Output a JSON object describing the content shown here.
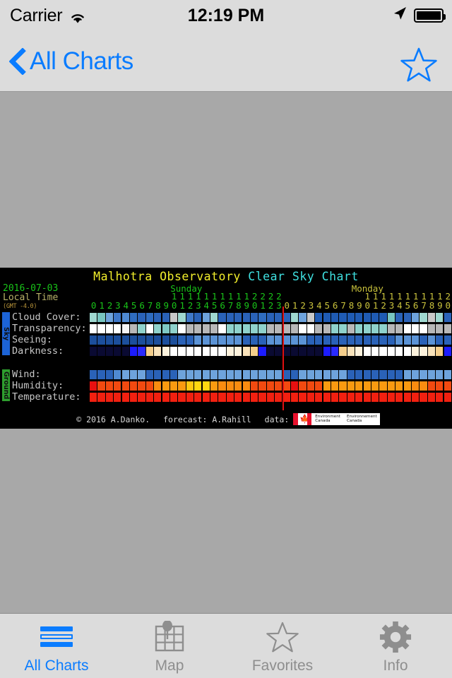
{
  "statusbar": {
    "carrier": "Carrier",
    "time": "12:19 PM",
    "wifi_icon": "wifi-icon",
    "location_icon": "location-arrow-icon",
    "battery_icon": "battery-full-icon"
  },
  "navbar": {
    "back_label": "All Charts",
    "back_icon": "chevron-left-icon",
    "favorite_icon": "star-outline-icon"
  },
  "chart": {
    "title_observatory": "Malhotra Observatory",
    "title_suffix": "Clear Sky Chart",
    "date": "2016-07-03",
    "timebase": "Local Time",
    "gmt_offset": "(GMT -4.0)",
    "colors": {
      "title_observatory": "#f2ef2c",
      "title_suffix": "#3fe0e0",
      "sunday": "#19c419",
      "monday": "#c9c23c",
      "sky_tab_bg": "#1c63d6",
      "ground_tab_bg": "#2e9e2e",
      "now_line": "#e01010",
      "background": "#000000"
    },
    "footer": {
      "copyright": "© 2016 A.Danko.",
      "forecast": "forecast: A.Rahill",
      "data_label": "data:",
      "agency_en": "Environment\nCanada",
      "agency_fr": "Environnement\nCanada",
      "flag_icon": "canada-flag-icon"
    },
    "now_line_column": 24,
    "groups": [
      {
        "tab": "Sky",
        "rows": [
          "Cloud Cover:",
          "Transparency:",
          "Seeing:",
          "Darkness:"
        ]
      },
      {
        "tab": "Ground",
        "rows": [
          "Wind:",
          "Humidity:",
          "Temperature:"
        ]
      }
    ]
  },
  "chart_data": {
    "type": "heatmap",
    "title": "Malhotra Observatory Clear Sky Chart",
    "xlabel": "Local Time (GMT -4.0)",
    "ylabel": "",
    "grid": false,
    "legend_position": "none",
    "days": [
      {
        "name": "Sunday",
        "hours": [
          0,
          1,
          2,
          3,
          4,
          5,
          6,
          7,
          8,
          9,
          10,
          11,
          12,
          13,
          14,
          15,
          16,
          17,
          18,
          19,
          20,
          21,
          22,
          23
        ],
        "color": "#19c419"
      },
      {
        "name": "Monday",
        "hours": [
          0,
          1,
          2,
          3,
          4,
          5,
          6,
          7,
          8,
          9,
          10,
          11,
          12,
          13,
          14,
          15,
          16,
          17,
          18,
          19,
          20
        ],
        "color": "#c9c23c"
      }
    ],
    "x": [
      "Sun 00",
      "Sun 01",
      "Sun 02",
      "Sun 03",
      "Sun 04",
      "Sun 05",
      "Sun 06",
      "Sun 07",
      "Sun 08",
      "Sun 09",
      "Sun 10",
      "Sun 11",
      "Sun 12",
      "Sun 13",
      "Sun 14",
      "Sun 15",
      "Sun 16",
      "Sun 17",
      "Sun 18",
      "Sun 19",
      "Sun 20",
      "Sun 21",
      "Sun 22",
      "Sun 23",
      "Mon 00",
      "Mon 01",
      "Mon 02",
      "Mon 03",
      "Mon 04",
      "Mon 05",
      "Mon 06",
      "Mon 07",
      "Mon 08",
      "Mon 09",
      "Mon 10",
      "Mon 11",
      "Mon 12",
      "Mon 13",
      "Mon 14",
      "Mon 15",
      "Mon 16",
      "Mon 17",
      "Mon 18",
      "Mon 19",
      "Mon 20"
    ],
    "series": [
      {
        "name": "Cloud Cover",
        "group": "Sky",
        "colors": [
          "#9fd8d0",
          "#78c5c0",
          "#6ea3dc",
          "#3f78c8",
          "#4f8ad2",
          "#2f6cc0",
          "#2a62b8",
          "#2f6cc0",
          "#2a62b8",
          "#2a62b8",
          "#c9c9c9",
          "#9fd8d0",
          "#3f78c8",
          "#2a62b8",
          "#6ea3dc",
          "#9fd8d0",
          "#2a62b8",
          "#2a62b8",
          "#2a62b8",
          "#2a62b8",
          "#2a62b8",
          "#2f6cc0",
          "#2a62b8",
          "#2a62b8",
          "#2a62b8",
          "#9fd8d0",
          "#6ea3dc",
          "#c9c9c9",
          "#1f5bb4",
          "#1f5bb4",
          "#1f5bb4",
          "#1f5bb4",
          "#1f5bb4",
          "#1f5bb4",
          "#1f5bb4",
          "#1f5bb4",
          "#1f5bb4",
          "#78c5c0",
          "#2a62b8",
          "#2a62b8",
          "#6ea3dc",
          "#9fd8d0",
          "#c9c9c9",
          "#9fd8d0",
          "#2a62b8"
        ]
      },
      {
        "name": "Transparency",
        "group": "Sky",
        "colors": [
          "#ffffff",
          "#ffffff",
          "#ffffff",
          "#ffffff",
          "#f6f6f6",
          "#b8b8b8",
          "#8fd2cc",
          "#ffffff",
          "#8fd2cc",
          "#7ec9c4",
          "#8fd2cc",
          "#ffffff",
          "#b8b8b8",
          "#b8b8b8",
          "#b8b8b8",
          "#b8b8b8",
          "#ffffff",
          "#8fd2cc",
          "#8fd2cc",
          "#8fd2cc",
          "#8fd2cc",
          "#8fd2cc",
          "#b8b8b8",
          "#b8b8b8",
          "#b8b8b8",
          "#b8b8b8",
          "#ffffff",
          "#ffffff",
          "#b8b8b8",
          "#b8b8b8",
          "#8fd2cc",
          "#8fd2cc",
          "#b8b8b8",
          "#8fd2cc",
          "#8fd2cc",
          "#8fd2cc",
          "#8fd2cc",
          "#b8b8b8",
          "#b8b8b8",
          "#ffffff",
          "#ffffff",
          "#ffffff",
          "#b8b8b8",
          "#b8b8b8",
          "#b8b8b8"
        ]
      },
      {
        "name": "Seeing",
        "group": "Sky",
        "colors": [
          "#1c4f9c",
          "#1c4f9c",
          "#1c4f9c",
          "#1c4f9c",
          "#1c4f9c",
          "#1c4f9c",
          "#1c4f9c",
          "#1c4f9c",
          "#1c4f9c",
          "#1c4f9c",
          "#1c4f9c",
          "#2a62b8",
          "#2a62b8",
          "#5b93d6",
          "#5b93d6",
          "#5b93d6",
          "#5b93d6",
          "#5b93d6",
          "#5b93d6",
          "#2a62b8",
          "#2a62b8",
          "#2a62b8",
          "#5b93d6",
          "#5b93d6",
          "#5b93d6",
          "#5b93d6",
          "#5b93d6",
          "#2a62b8",
          "#2a62b8",
          "#2a62b8",
          "#2a62b8",
          "#2a62b8",
          "#2a62b8",
          "#2a62b8",
          "#2a62b8",
          "#2a62b8",
          "#2a62b8",
          "#2a62b8",
          "#5b93d6",
          "#5b93d6",
          "#5b93d6",
          "#2a62b8",
          "#5b93d6",
          "#2a62b8",
          "#2a62b8"
        ]
      },
      {
        "name": "Darkness",
        "group": "Sky",
        "colors": [
          "#0a0a32",
          "#0a0a32",
          "#0a0a32",
          "#0a0a32",
          "#0a0a32",
          "#1c1cff",
          "#2a2aff",
          "#f5cf8c",
          "#f9e3bb",
          "#fdf2dd",
          "#ffffff",
          "#ffffff",
          "#ffffff",
          "#ffffff",
          "#ffffff",
          "#ffffff",
          "#ffffff",
          "#fdf2dd",
          "#fdf2dd",
          "#f9e3bb",
          "#f5cf8c",
          "#1c1cff",
          "#0a0a32",
          "#0a0a32",
          "#0a0a32",
          "#0a0a32",
          "#0a0a32",
          "#0a0a32",
          "#0a0a32",
          "#1c1cff",
          "#2a2aff",
          "#f5cf8c",
          "#f9e3bb",
          "#fdf2dd",
          "#ffffff",
          "#ffffff",
          "#ffffff",
          "#ffffff",
          "#ffffff",
          "#ffffff",
          "#fdf2dd",
          "#fdf2dd",
          "#f9e3bb",
          "#f5cf8c",
          "#1c1cff"
        ]
      },
      {
        "name": "Wind",
        "group": "Ground",
        "colors": [
          "#2a62b8",
          "#2a62b8",
          "#2a62b8",
          "#4f8ad2",
          "#6ea3dc",
          "#6ea3dc",
          "#6ea3dc",
          "#2a62b8",
          "#2a62b8",
          "#2a62b8",
          "#2a62b8",
          "#6ea3dc",
          "#6ea3dc",
          "#6ea3dc",
          "#6ea3dc",
          "#6ea3dc",
          "#6ea3dc",
          "#6ea3dc",
          "#6ea3dc",
          "#6ea3dc",
          "#6ea3dc",
          "#6ea3dc",
          "#6ea3dc",
          "#6ea3dc",
          "#2a62b8",
          "#2a62b8",
          "#6ea3dc",
          "#6ea3dc",
          "#6ea3dc",
          "#6ea3dc",
          "#6ea3dc",
          "#6ea3dc",
          "#2a62b8",
          "#2a62b8",
          "#2a62b8",
          "#2a62b8",
          "#2a62b8",
          "#2a62b8",
          "#2a62b8",
          "#6ea3dc",
          "#6ea3dc",
          "#6ea3dc",
          "#6ea3dc",
          "#6ea3dc",
          "#6ea3dc"
        ]
      },
      {
        "name": "Humidity",
        "group": "Ground",
        "colors": [
          "#e81010",
          "#f24a10",
          "#f24a10",
          "#f24a10",
          "#f24a10",
          "#f24a10",
          "#f24a10",
          "#f24a10",
          "#fa8c10",
          "#fa9a10",
          "#fa9a10",
          "#fa9a10",
          "#ffc810",
          "#ffd810",
          "#ffd810",
          "#fa9a10",
          "#fa8c10",
          "#fa8c10",
          "#fa8c10",
          "#fa8c10",
          "#f24a10",
          "#f24a10",
          "#f24a10",
          "#f24a10",
          "#f24a10",
          "#e81010",
          "#f24a10",
          "#f24a10",
          "#f24a10",
          "#fa9a10",
          "#fa9a10",
          "#fa9a10",
          "#fa9a10",
          "#fa9a10",
          "#fa9a10",
          "#fa9a10",
          "#fa9a10",
          "#fa9a10",
          "#fa9a10",
          "#fa9a10",
          "#fa8c10",
          "#fa8c10",
          "#f24a10",
          "#f24a10",
          "#f24a10"
        ]
      },
      {
        "name": "Temperature",
        "group": "Ground",
        "colors": [
          "#f22010",
          "#f22010",
          "#f22010",
          "#f22010",
          "#f22010",
          "#f22010",
          "#f22010",
          "#f22010",
          "#f22010",
          "#f22010",
          "#f22010",
          "#f22010",
          "#f22010",
          "#f22010",
          "#f22010",
          "#f22010",
          "#f22010",
          "#f22010",
          "#f22010",
          "#f22010",
          "#f22010",
          "#f22010",
          "#f22010",
          "#f22010",
          "#f22010",
          "#f22010",
          "#f22010",
          "#f22010",
          "#f22010",
          "#f22010",
          "#f22010",
          "#f22010",
          "#f22010",
          "#f22010",
          "#f22010",
          "#f22010",
          "#f22010",
          "#f22010",
          "#f22010",
          "#f22010",
          "#f22010",
          "#f22010",
          "#f22010",
          "#f22010",
          "#f22010"
        ]
      }
    ]
  },
  "tabbar": {
    "items": [
      {
        "label": "All Charts",
        "icon": "lines-icon",
        "active": true
      },
      {
        "label": "Map",
        "icon": "map-pin-icon",
        "active": false
      },
      {
        "label": "Favorites",
        "icon": "star-outline-icon",
        "active": false
      },
      {
        "label": "Info",
        "icon": "gear-icon",
        "active": false
      }
    ]
  }
}
